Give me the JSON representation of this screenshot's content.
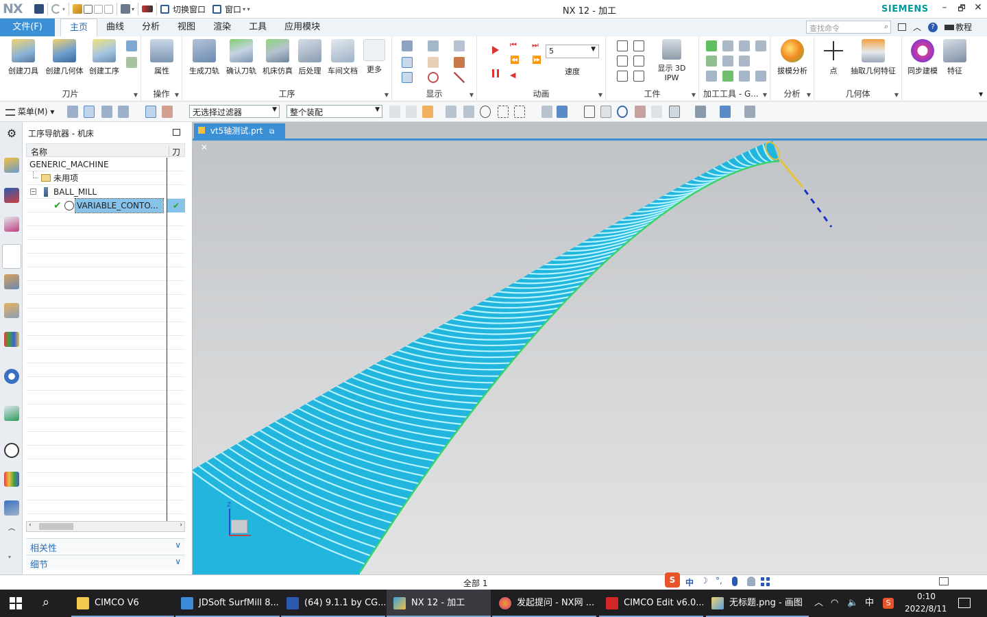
{
  "titlebar": {
    "logo": "NX",
    "switch_window": "切换窗口",
    "window_menu": "窗口",
    "title": "NX 12 - 加工",
    "brand": "SIEMENS",
    "minimize": "–",
    "restore": "🗗",
    "close": "✕"
  },
  "tabs": [
    {
      "label": "文件(F)"
    },
    {
      "label": "主页"
    },
    {
      "label": "曲线"
    },
    {
      "label": "分析"
    },
    {
      "label": "视图"
    },
    {
      "label": "渲染"
    },
    {
      "label": "工具"
    },
    {
      "label": "应用模块"
    }
  ],
  "search": {
    "placeholder": "查找命令",
    "tutorial": "教程"
  },
  "ribbon": {
    "groups": {
      "cutter": "刀片",
      "operation": "操作",
      "program": "工序",
      "display": "显示",
      "animation": "动画",
      "workpiece": "工件",
      "machining_tools": "加工工具 - G...",
      "analysis": "分析",
      "geometry": "几何体"
    },
    "buttons": {
      "create_tool": "创建刀具",
      "create_geometry": "创建几何体",
      "create_operation": "创建工序",
      "properties": "属性",
      "generate_path": "生成刀轨",
      "verify_path": "确认刀轨",
      "machine_sim": "机床仿真",
      "postprocess": "后处理",
      "shop_doc": "车间文档",
      "more": "更多",
      "speed": "速度",
      "show_ipw": "显示 3D IPW",
      "draft_analysis": "拔模分析",
      "point": "点",
      "extract_geometry": "抽取几何特征",
      "sync_modeling": "同步建模",
      "feature": "特征"
    },
    "speed_value": "5"
  },
  "toolbar2": {
    "menu": "菜单(M)",
    "filter": "无选择过滤器",
    "assembly": "整个装配"
  },
  "navigator": {
    "title": "工序导航器 - 机床",
    "col_name": "名称",
    "col_path": "刀轨",
    "rows": [
      {
        "name": "GENERIC_MACHINE"
      },
      {
        "name": "未用项"
      },
      {
        "name": "BALL_MILL"
      },
      {
        "name": "VARIABLE_CONTO..."
      }
    ],
    "dependencies": "相关性",
    "details": "细节"
  },
  "graphics": {
    "doc_tab": "vt5轴测试.prt",
    "triad_z": "Z",
    "colors": {
      "part": "#22b6de",
      "ridge": "#b8f4ff",
      "edge": "#37d36a",
      "tool": "#e6c23a",
      "axis": "#1634c8"
    }
  },
  "status": {
    "text": "全部 1"
  },
  "taskbar": {
    "items": [
      {
        "label": "CIMCO V6"
      },
      {
        "label": "JDSoft SurfMill 8..."
      },
      {
        "label": "(64)  9.1.1 by CG..."
      },
      {
        "label": "NX 12 - 加工"
      },
      {
        "label": "发起提问 - NX网 ..."
      },
      {
        "label": "CIMCO Edit v6.0..."
      },
      {
        "label": "无标题.png - 画图"
      }
    ],
    "ime": "中",
    "time": "0:10",
    "date": "2022/8/11"
  }
}
